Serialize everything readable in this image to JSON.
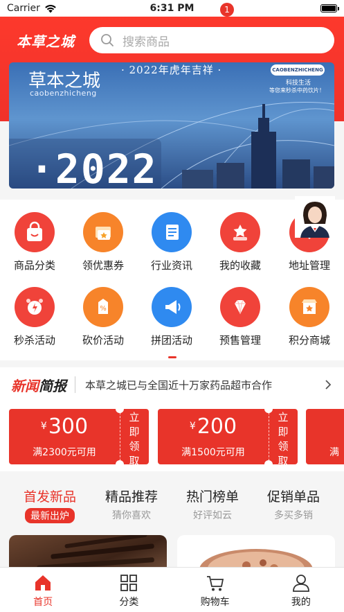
{
  "status_bar": {
    "carrier": "Carrier",
    "time": "6:31 PM"
  },
  "header": {
    "logo": "本草之城",
    "search_placeholder": "搜索商品"
  },
  "banner": {
    "title": "草本之城",
    "pinyin": "caobenzhicheng",
    "slogan": "· 2022年虎年吉祥 ·",
    "tag": "CAOBENZHICHENG",
    "sub1": "科技生活",
    "sub2": "等您来秒杀中药饮片！",
    "year": "·2022"
  },
  "categories": [
    {
      "label": "商品分类",
      "icon": "shopping-bag-icon",
      "color": "#f0433a"
    },
    {
      "label": "领优惠券",
      "icon": "coupon-icon",
      "color": "#f7842a"
    },
    {
      "label": "行业资讯",
      "icon": "document-icon",
      "color": "#2f8af0"
    },
    {
      "label": "我的收藏",
      "icon": "star-hand-icon",
      "color": "#f0433a"
    },
    {
      "label": "地址管理",
      "icon": "location-icon",
      "color": "#f0433a"
    },
    {
      "label": "秒杀活动",
      "icon": "alarm-clock-icon",
      "color": "#f0433a"
    },
    {
      "label": "砍价活动",
      "icon": "price-tag-icon",
      "color": "#f7842a"
    },
    {
      "label": "拼团活动",
      "icon": "megaphone-icon",
      "color": "#2f8af0"
    },
    {
      "label": "预售管理",
      "icon": "diamond-icon",
      "color": "#f0433a"
    },
    {
      "label": "积分商城",
      "icon": "store-icon",
      "color": "#f7842a"
    }
  ],
  "news": {
    "logo_a": "新闻",
    "logo_b": "简报",
    "headline": "本草之城已与全国近十万家药品超市合作"
  },
  "coupons": [
    {
      "currency": "¥",
      "amount": "300",
      "condition": "满2300元可用",
      "action": "立即领取"
    },
    {
      "currency": "¥",
      "amount": "200",
      "condition": "满1500元可用",
      "action": "立即领取"
    },
    {
      "currency": "",
      "amount": "",
      "condition": "满",
      "action": ""
    }
  ],
  "tabs": [
    {
      "title": "首发新品",
      "subtitle": "最新出炉"
    },
    {
      "title": "精品推荐",
      "subtitle": "猜你喜欢"
    },
    {
      "title": "热门榜单",
      "subtitle": "好评如云"
    },
    {
      "title": "促销单品",
      "subtitle": "多买多销"
    }
  ],
  "tabbar": [
    {
      "label": "首页",
      "icon": "home-icon"
    },
    {
      "label": "分类",
      "icon": "grid-icon"
    },
    {
      "label": "购物车",
      "icon": "cart-icon"
    },
    {
      "label": "我的",
      "icon": "user-icon"
    }
  ],
  "cart_count": "1",
  "colors": {
    "brand_red": "#e8342a",
    "banner_blue": "#3a6fb5"
  }
}
